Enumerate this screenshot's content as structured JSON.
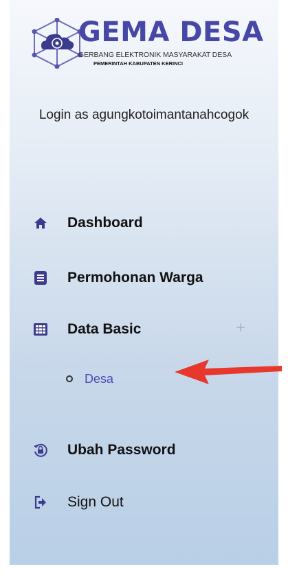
{
  "brand": {
    "title": "GEMA DESA",
    "subtitle": "GERBANG ELEKTRONIK MASYARAKAT DESA",
    "government": "PEMERINTAH KABUPATEN KERINCI"
  },
  "user": {
    "login_text": "Login as agungkotoimantanahcogok"
  },
  "nav": {
    "dashboard": "Dashboard",
    "permohonan": "Permohonan Warga",
    "data_basic": "Data Basic",
    "data_basic_toggle": "+",
    "desa": "Desa",
    "ubah_password": "Ubah Password",
    "sign_out": "Sign Out"
  },
  "colors": {
    "brand": "#4647a6",
    "icon": "#3c3b8e",
    "link": "#4a4ab0",
    "annotation_arrow": "#e8382d"
  }
}
